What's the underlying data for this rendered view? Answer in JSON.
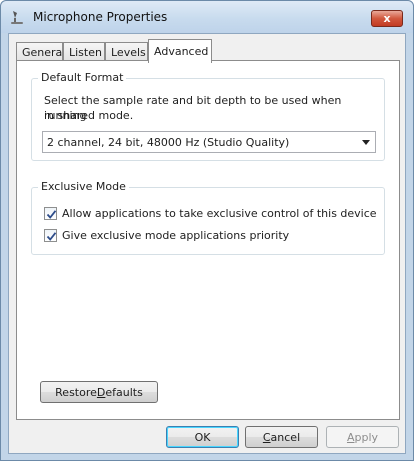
{
  "window": {
    "title": "Microphone Properties",
    "close_label": "x"
  },
  "tabs": [
    {
      "label": "General"
    },
    {
      "label": "Listen"
    },
    {
      "label": "Levels"
    },
    {
      "label": "Advanced",
      "active": true
    }
  ],
  "default_format": {
    "legend": "Default Format",
    "description_line1": "Select the sample rate and bit depth to be used when running",
    "description_line2": "in shared mode.",
    "selected_value": "2 channel, 24 bit, 48000 Hz (Studio Quality)"
  },
  "exclusive_mode": {
    "legend": "Exclusive Mode",
    "options": [
      {
        "label": "Allow applications to take exclusive control of this device",
        "checked": true
      },
      {
        "label": "Give exclusive mode applications priority",
        "checked": true
      }
    ]
  },
  "buttons": {
    "restore_prefix": "Restore ",
    "restore_accel": "D",
    "restore_suffix": "efaults",
    "ok": "OK",
    "cancel_accel": "C",
    "cancel_suffix": "ancel",
    "apply_accel": "A",
    "apply_suffix": "pply"
  },
  "colors": {
    "close_button": "#c23b22",
    "title_bar": "#c8dbee",
    "default_button_focus": "#48d6ff"
  }
}
